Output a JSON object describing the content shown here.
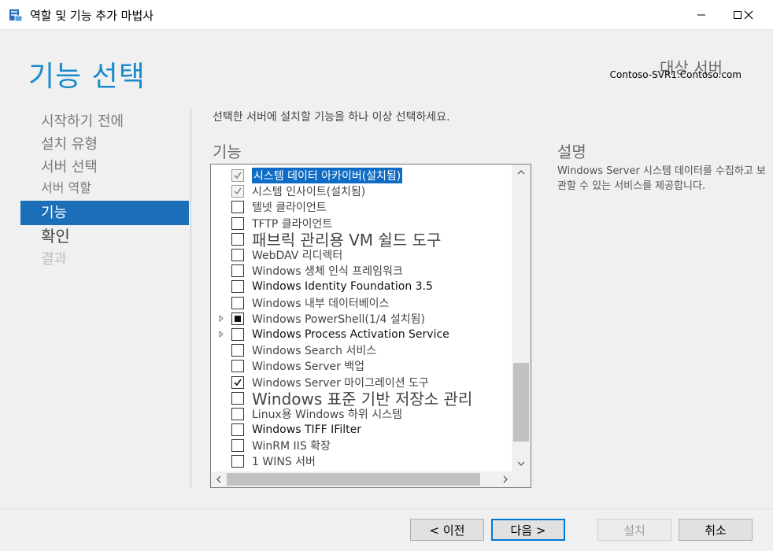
{
  "window": {
    "title": "역할 및 기능 추가 마법사"
  },
  "page": {
    "heading": "기능 선택"
  },
  "target": {
    "label": "대상 서버",
    "server": "Contoso-SVR1.Contoso.com"
  },
  "nav": [
    {
      "label": "시작하기 전에",
      "state": "normal"
    },
    {
      "label": "설치 유형",
      "state": "normal"
    },
    {
      "label": "서버 선택",
      "state": "normal"
    },
    {
      "label": "서버 역할",
      "state": "sub"
    },
    {
      "label": "기능",
      "state": "active"
    },
    {
      "label": "확인",
      "state": "current"
    },
    {
      "label": "결과",
      "state": "disabled"
    }
  ],
  "main": {
    "instruction": "선택한 서버에 설치할 기능을 하나 이상 선택하세요.",
    "features_label": "기능",
    "features": [
      {
        "label": "시스템 데이터 아카이버(설치됨)",
        "state": "checked-disabled",
        "selected": true
      },
      {
        "label": "시스템 인사이트(설치됨)",
        "state": "checked-disabled"
      },
      {
        "label": "텔넷 클라이언트",
        "state": "unchecked"
      },
      {
        "label": "TFTP 클라이언트",
        "state": "unchecked"
      },
      {
        "label": "패브릭 관리용 VM 쉴드 도구",
        "state": "unchecked",
        "big": true
      },
      {
        "label": "WebDAV 리디렉터",
        "state": "unchecked"
      },
      {
        "label": "Windows 생체 인식 프레임워크",
        "state": "unchecked"
      },
      {
        "label": "Windows Identity Foundation 3.5",
        "state": "unchecked",
        "bold": true
      },
      {
        "label": "Windows 내부 데이터베이스",
        "state": "unchecked"
      },
      {
        "label": "Windows PowerShell(1/4 설치됨)",
        "state": "partial",
        "expandable": true
      },
      {
        "label": "Windows Process Activation Service",
        "state": "unchecked",
        "expandable": true,
        "bold": true
      },
      {
        "label": "Windows Search 서비스",
        "state": "unchecked"
      },
      {
        "label": "Windows Server 백업",
        "state": "unchecked"
      },
      {
        "label": "Windows Server 마이그레이션 도구",
        "state": "checked"
      },
      {
        "label": "Windows 표준 기반 저장소 관리",
        "state": "unchecked",
        "big": true
      },
      {
        "label": "Linux용 Windows 하위 시스템",
        "state": "unchecked"
      },
      {
        "label": "Windows TIFF IFilter",
        "state": "unchecked",
        "bold": true
      },
      {
        "label": "WinRM IIS 확장",
        "state": "unchecked"
      },
      {
        "label": "1 WINS 서버",
        "state": "unchecked"
      }
    ]
  },
  "description": {
    "label": "설명",
    "text": "Windows Server 시스템 데이터를 수집하고 보관할 수 있는 서비스를 제공합니다."
  },
  "buttons": {
    "previous": "< 이전",
    "next": "다음 >",
    "install": "설치",
    "cancel": "취소"
  },
  "colors": {
    "accent": "#1b8acb",
    "selection": "#1b6fb8"
  }
}
